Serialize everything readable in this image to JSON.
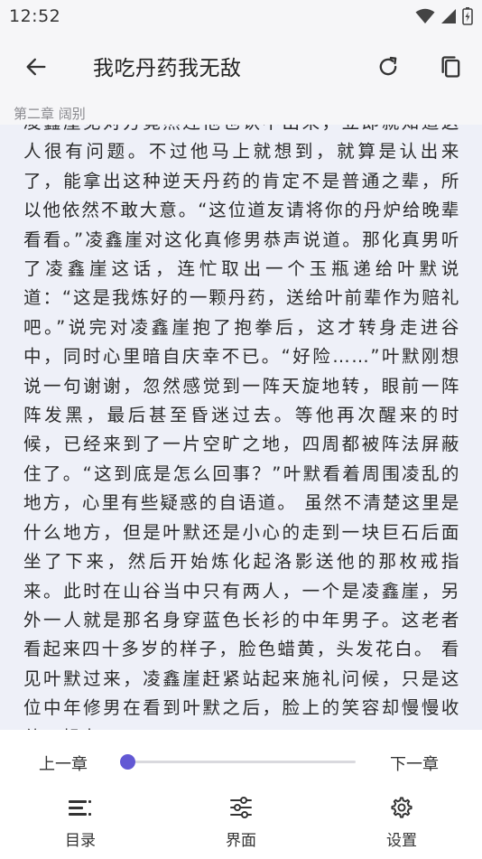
{
  "status_bar": {
    "time": "12:52"
  },
  "app_bar": {
    "title": "我吃丹药我无敌"
  },
  "chapter": {
    "label": "第二章 阔别"
  },
  "reader": {
    "text": "凌鑫崖见对方竟然连他也认不出来，立即就知道这人很有问题。不过他马上就想到，就算是认出来了，能拿出这种逆天丹药的肯定不是普通之辈，所以他依然不敢大意。“这位道友请将你的丹炉给晚辈看看。”凌鑫崖对这化真修男恭声说道。那化真男听了凌鑫崖这话，连忙取出一个玉瓶递给叶默说道：“这是我炼好的一颗丹药，送给叶前辈作为赔礼吧。”说完对凌鑫崖抱了抱拳后，这才转身走进谷中，同时心里暗自庆幸不已。“好险……”叶默刚想说一句谢谢，忽然感觉到一阵天旋地转，眼前一阵阵发黑，最后甚至昏迷过去。等他再次醒来的时候，已经来到了一片空旷之地，四周都被阵法屏蔽住了。“这到底是怎么回事？”叶默看着周围凌乱的地方，心里有些疑惑的自语道。 虽然不清楚这里是什么地方，但是叶默还是小心的走到一块巨石后面坐了下来，然后开始炼化起洛影送他的那枚戒指来。此时在山谷当中只有两人，一个是凌鑫崖，另外一人就是那名身穿蓝色长衫的中年男子。这老者看起来四十多岁的样子，脸色蜡黄，头发花白。 看见叶默过来，凌鑫崖赶紧站起来施礼问候，只是这位中年修男在看到叶默之后，脸上的笑容却慢慢收敛了起来。"
  },
  "controls": {
    "prev_label": "上一章",
    "next_label": "下一章",
    "progress": 0.01,
    "accent_color": "#6258d4"
  },
  "bottom_nav": [
    {
      "label": "目录",
      "icon": "toc-list-icon"
    },
    {
      "label": "界面",
      "icon": "sliders-icon"
    },
    {
      "label": "设置",
      "icon": "gear-icon"
    }
  ]
}
